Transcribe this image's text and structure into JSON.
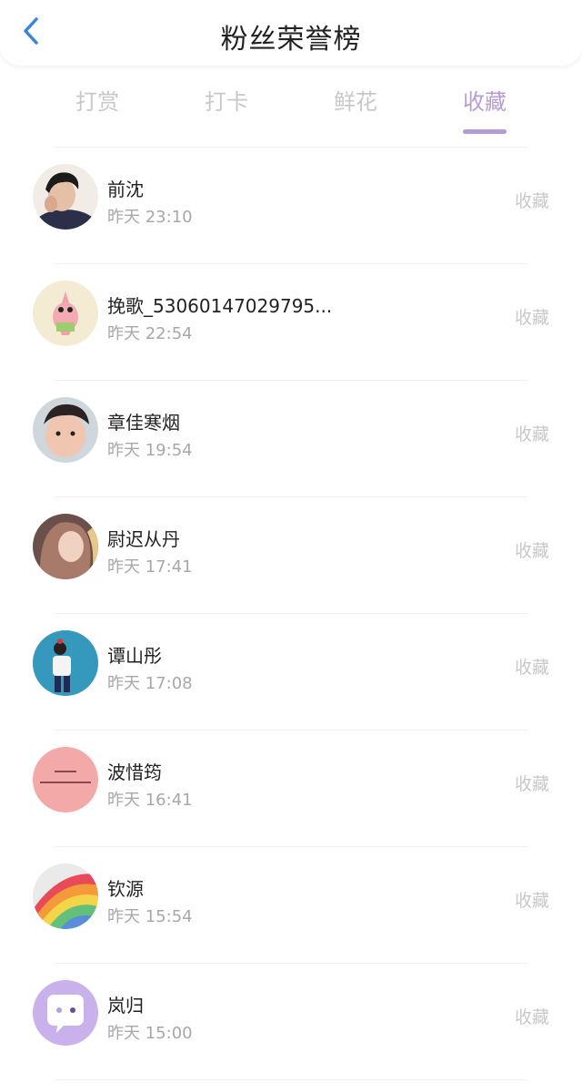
{
  "header": {
    "title": "粉丝荣誉榜",
    "back_icon": "chevron-left-icon",
    "accent": "#3a86d6"
  },
  "tabs": [
    {
      "label": "打赏",
      "active": false
    },
    {
      "label": "打卡",
      "active": false
    },
    {
      "label": "鲜花",
      "active": false
    },
    {
      "label": "收藏",
      "active": true
    }
  ],
  "colors": {
    "active_tab": "#b89cd6",
    "inactive_tab": "#c8c8cc",
    "underline": "#b59ad8"
  },
  "fans": [
    {
      "name": "前沈",
      "time": "昨天 23:10",
      "action": "收藏"
    },
    {
      "name": "挽歌_53060147029795...",
      "time": "昨天 22:54",
      "action": "收藏"
    },
    {
      "name": "章佳寒烟",
      "time": "昨天 19:54",
      "action": "收藏"
    },
    {
      "name": "尉迟从丹",
      "time": "昨天 17:41",
      "action": "收藏"
    },
    {
      "name": "谭山彤",
      "time": "昨天 17:08",
      "action": "收藏"
    },
    {
      "name": "波惜筠",
      "time": "昨天 16:41",
      "action": "收藏"
    },
    {
      "name": "钦源",
      "time": "昨天 15:54",
      "action": "收藏"
    },
    {
      "name": "岚归",
      "time": "昨天 15:00",
      "action": "收藏"
    }
  ]
}
